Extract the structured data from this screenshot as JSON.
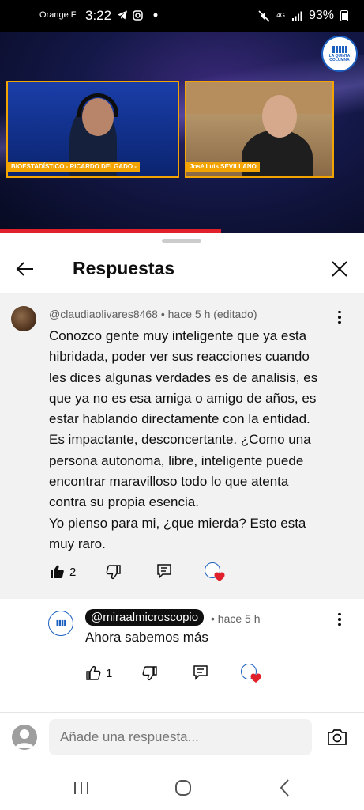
{
  "status_bar": {
    "carrier": "Orange F",
    "time": "3:22",
    "network": "4G",
    "battery": "93%"
  },
  "video": {
    "logo_text": "LA QUINTA COLUMNA",
    "left_label": "BIOESTADÍSTICO - RICARDO DELGADO -",
    "right_label": "José Luis SEVILLANO"
  },
  "sheet": {
    "title": "Respuestas"
  },
  "comment": {
    "author": "@claudiaolivares8468",
    "meta": "@claudiaolivares8468 • hace 5 h (editado)",
    "text": "Conozco gente muy inteligente que ya esta\nhibridada, poder ver sus reacciones cuando\nles dices algunas verdades es de analisis, es\nque ya no es esa amiga o amigo de años, es\nestar hablando directamente con la entidad.\nEs impactante, desconcertante. ¿Como una\npersona autonoma, libre, inteligente puede\nencontrar maravilloso todo lo que atenta\ncontra su propia esencia.\nYo pienso para mi, ¿que mierda? Esto esta\nmuy raro.",
    "likes": "2"
  },
  "reply": {
    "handle": "@miraalmicroscopio",
    "meta": "• hace 5 h",
    "text": "Ahora sabemos más",
    "likes": "1"
  },
  "compose": {
    "placeholder": "Añade una respuesta..."
  },
  "colors": {
    "accent_red": "#e0202a",
    "heart": "#e0202a",
    "brand_blue": "#1b5fbf"
  }
}
